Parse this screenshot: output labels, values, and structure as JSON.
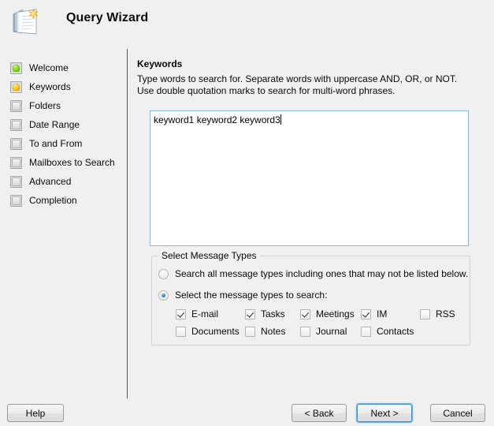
{
  "header": {
    "title": "Query Wizard",
    "icon": "notepad-star-icon"
  },
  "sidebar": {
    "items": [
      {
        "label": "Welcome",
        "state": "done",
        "icon": "step-complete-icon"
      },
      {
        "label": "Keywords",
        "state": "current",
        "icon": "step-current-icon"
      },
      {
        "label": "Folders",
        "state": "todo",
        "icon": "step-pending-icon"
      },
      {
        "label": "Date Range",
        "state": "todo",
        "icon": "step-pending-icon"
      },
      {
        "label": "To and From",
        "state": "todo",
        "icon": "step-pending-icon"
      },
      {
        "label": "Mailboxes to Search",
        "state": "todo",
        "icon": "step-pending-icon"
      },
      {
        "label": "Advanced",
        "state": "todo",
        "icon": "step-pending-icon"
      },
      {
        "label": "Completion",
        "state": "todo",
        "icon": "step-pending-icon"
      }
    ]
  },
  "main": {
    "section_title": "Keywords",
    "section_description": "Type words to search for. Separate words with uppercase AND, OR, or NOT. Use double quotation marks to search for multi-word phrases.",
    "keywords_value": "keyword1 keyword2 keyword3",
    "keywords_placeholder": ""
  },
  "message_types": {
    "group_label": "Select Message Types",
    "radio_all_label": "Search all message types including ones that may not be listed below.",
    "radio_all_selected": false,
    "radio_select_label": "Select the message types to search:",
    "radio_select_selected": true,
    "checkboxes": [
      {
        "label": "E-mail",
        "checked": true
      },
      {
        "label": "Tasks",
        "checked": true
      },
      {
        "label": "Meetings",
        "checked": true
      },
      {
        "label": "IM",
        "checked": true
      },
      {
        "label": "RSS",
        "checked": false
      },
      {
        "label": "Documents",
        "checked": false
      },
      {
        "label": "Notes",
        "checked": false
      },
      {
        "label": "Journal",
        "checked": false
      },
      {
        "label": "Contacts",
        "checked": false
      }
    ]
  },
  "footer": {
    "help_label": "Help",
    "back_label": "< Back",
    "next_label": "Next >",
    "cancel_label": "Cancel"
  },
  "colors": {
    "window_background": "#f0f0f0",
    "focus_blue": "#5fb8e8",
    "field_border": "#8fb8d8",
    "step_done": "#7ed321",
    "step_current": "#f5c518",
    "radio_dot": "#1e84c8"
  }
}
